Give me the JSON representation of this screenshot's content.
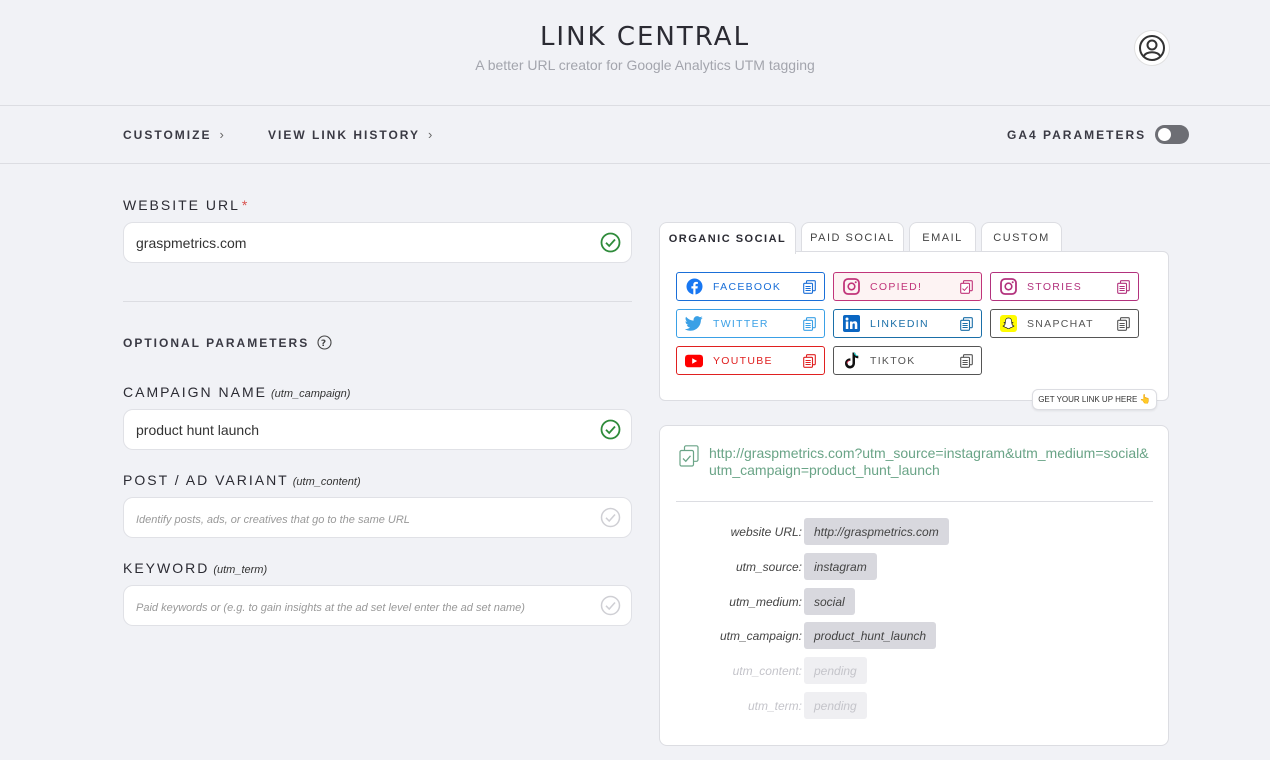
{
  "header": {
    "title": "LINK CENTRAL",
    "subtitle": "A better URL creator for Google Analytics UTM tagging"
  },
  "nav": {
    "customize": "CUSTOMIZE",
    "view_history": "VIEW LINK HISTORY",
    "ga4_label": "GA4 PARAMETERS",
    "ga4_enabled": false
  },
  "form": {
    "website_url": {
      "label": "WEBSITE URL",
      "required_mark": "*",
      "value": "graspmetrics.com"
    },
    "optional_heading": "OPTIONAL PARAMETERS",
    "campaign": {
      "label": "CAMPAIGN NAME",
      "param": "(utm_campaign)",
      "value": "product hunt launch"
    },
    "content": {
      "label": "POST / AD VARIANT",
      "param": "(utm_content)",
      "placeholder": "Identify posts, ads, or creatives that go to the same URL"
    },
    "keyword": {
      "label": "KEYWORD",
      "param": "(utm_term)",
      "placeholder": "Paid keywords or (e.g. to gain insights at the ad set level enter the ad set name)"
    }
  },
  "tabs": [
    "ORGANIC SOCIAL",
    "PAID SOCIAL",
    "EMAIL",
    "CUSTOM"
  ],
  "active_tab": "ORGANIC SOCIAL",
  "networks": [
    {
      "label": "FACEBOOK",
      "icon": "facebook-icon",
      "color": "#1a6fd8"
    },
    {
      "label": "COPIED!",
      "icon": "instagram-icon",
      "color": "#c1357a",
      "copied": true
    },
    {
      "label": "STORIES",
      "icon": "instagram-icon",
      "color": "#b2327d"
    },
    {
      "label": "TWITTER",
      "icon": "twitter-icon",
      "color": "#3aa0e6"
    },
    {
      "label": "LINKEDIN",
      "icon": "linkedin-icon",
      "color": "#1a6fa8"
    },
    {
      "label": "SNAPCHAT",
      "icon": "snapchat-icon",
      "color": "#555555"
    },
    {
      "label": "YOUTUBE",
      "icon": "youtube-icon",
      "color": "#e02020"
    },
    {
      "label": "TIKTOK",
      "icon": "tiktok-icon",
      "color": "#555555"
    }
  ],
  "get_link_label": "GET YOUR LINK UP HERE",
  "get_link_emoji": "👆",
  "output": {
    "url": "http://graspmetrics.com?utm_source=instagram&utm_medium=social&utm_campaign=product_hunt_launch",
    "params": [
      {
        "key": "website URL:",
        "value": "http://graspmetrics.com",
        "pending": false
      },
      {
        "key": "utm_source:",
        "value": "instagram",
        "pending": false
      },
      {
        "key": "utm_medium:",
        "value": "social",
        "pending": false
      },
      {
        "key": "utm_campaign:",
        "value": "product_hunt_launch",
        "pending": false
      },
      {
        "key": "utm_content:",
        "value": "pending",
        "pending": true
      },
      {
        "key": "utm_term:",
        "value": "pending",
        "pending": true
      }
    ]
  }
}
